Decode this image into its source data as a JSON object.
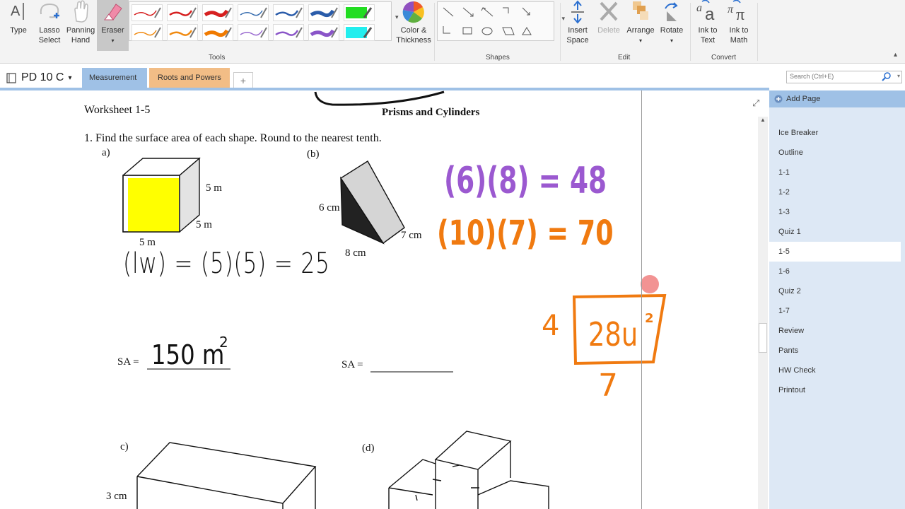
{
  "ribbon": {
    "type_label": "Type",
    "lasso_label_1": "Lasso",
    "lasso_label_2": "Select",
    "pan_label_1": "Panning",
    "pan_label_2": "Hand",
    "eraser_label": "Eraser",
    "color_label_1": "Color &",
    "color_label_2": "Thickness",
    "insert_label_1": "Insert",
    "insert_label_2": "Space",
    "delete_label": "Delete",
    "arrange_label": "Arrange",
    "rotate_label": "Rotate",
    "ink_text_1": "Ink to",
    "ink_text_2": "Text",
    "ink_math_1": "Ink to",
    "ink_math_2": "Math",
    "groups": {
      "tools": "Tools",
      "shapes": "Shapes",
      "edit": "Edit",
      "convert": "Convert"
    },
    "pen_colors": [
      "#d62020",
      "#d62020",
      "#d62020",
      "#3a6fb0",
      "#2a5caa",
      "#2a5caa",
      "#22dd22",
      "#f08a10",
      "#f08a10",
      "#f07a00",
      "#9a6ad0",
      "#8a55c8",
      "#8a55c8",
      "#22eeee"
    ]
  },
  "notebook": {
    "name": "PD 10 C"
  },
  "tabs": [
    {
      "label": "Measurement",
      "color": "#9fc1e6"
    },
    {
      "label": "Roots and Powers",
      "color": "#f2bd86"
    }
  ],
  "add_tab": "+",
  "search": {
    "placeholder": "Search (Ctrl+E)"
  },
  "sidebar": {
    "add_page": "Add Page",
    "pages": [
      "Ice Breaker",
      "Outline",
      "1-1",
      "1-2",
      "1-3",
      "Quiz 1",
      "1-5",
      "1-6",
      "Quiz 2",
      "1-7",
      "Review",
      "Pants",
      "HW Check",
      "Printout"
    ],
    "selected": "1-5"
  },
  "worksheet": {
    "header_left": "Worksheet 1-5",
    "header_center": "Prisms and Cylinders",
    "question": "1.  Find the surface area of each shape.  Round to the nearest tenth.",
    "label_a": "a)",
    "label_b": "(b)",
    "label_c": "c)",
    "label_d": "(d)",
    "cube_5m_1": "5 m",
    "cube_5m_2": "5 m",
    "cube_5m_3": "5 m",
    "tri_6cm": "6 cm",
    "tri_7cm": "7 cm",
    "tri_8cm": "8 cm",
    "box_3cm": "3 cm",
    "sa_label": "SA =",
    "sa_label_2": "SA ="
  },
  "ink": {
    "lw": "(lw) = (5)(5) = 25",
    "sa_answer": "150 m",
    "sa_exp": "2",
    "purple": "(6)(8) = 48",
    "orange": "(10)(7) = 70",
    "box_value": "28u",
    "box_exp": "2",
    "left_num": "4",
    "bottom_num": "7",
    "colors": {
      "black": "#111111",
      "purple": "#9b59d0",
      "orange": "#f07a10",
      "highlight": "#ffff00"
    }
  }
}
